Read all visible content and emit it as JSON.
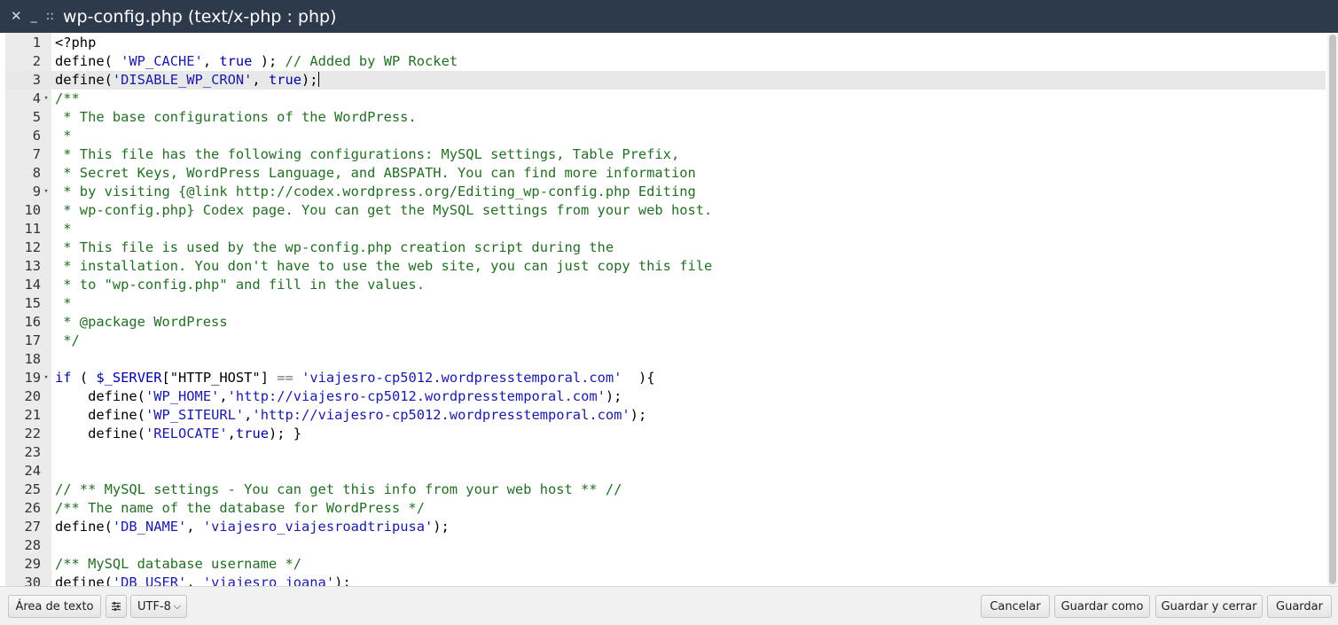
{
  "titlebar": {
    "close_glyph": "✕",
    "minimize_glyph": "_",
    "grip_glyph": "::",
    "title": "wp-config.php (text/x-php : php)"
  },
  "editor": {
    "lines": [
      {
        "n": "1",
        "fold": false,
        "active": false,
        "tokens": [
          [
            "plain",
            "<?php"
          ]
        ]
      },
      {
        "n": "2",
        "fold": false,
        "active": false,
        "tokens": [
          [
            "def",
            "define( "
          ],
          [
            "str",
            "'WP_CACHE'"
          ],
          [
            "plain",
            ", "
          ],
          [
            "kw",
            "true"
          ],
          [
            "plain",
            " ); "
          ],
          [
            "com",
            "// Added by WP Rocket"
          ]
        ]
      },
      {
        "n": "3",
        "fold": false,
        "active": true,
        "cursor": true,
        "tokens": [
          [
            "def",
            "define("
          ],
          [
            "str",
            "'DISABLE_WP_CRON'"
          ],
          [
            "plain",
            ", "
          ],
          [
            "kw",
            "true"
          ],
          [
            "plain",
            ");"
          ]
        ]
      },
      {
        "n": "4",
        "fold": true,
        "active": false,
        "tokens": [
          [
            "com",
            "/**"
          ]
        ]
      },
      {
        "n": "5",
        "fold": false,
        "active": false,
        "tokens": [
          [
            "com",
            " * The base configurations of the WordPress."
          ]
        ]
      },
      {
        "n": "6",
        "fold": false,
        "active": false,
        "tokens": [
          [
            "com",
            " *"
          ]
        ]
      },
      {
        "n": "7",
        "fold": false,
        "active": false,
        "tokens": [
          [
            "com",
            " * This file has the following configurations: MySQL settings, Table Prefix,"
          ]
        ]
      },
      {
        "n": "8",
        "fold": false,
        "active": false,
        "tokens": [
          [
            "com",
            " * Secret Keys, WordPress Language, and ABSPATH. You can find more information"
          ]
        ]
      },
      {
        "n": "9",
        "fold": true,
        "active": false,
        "tokens": [
          [
            "com",
            " * by visiting {@link http://codex.wordpress.org/Editing_wp-config.php Editing"
          ]
        ]
      },
      {
        "n": "10",
        "fold": false,
        "active": false,
        "tokens": [
          [
            "com",
            " * wp-config.php} Codex page. You can get the MySQL settings from your web host."
          ]
        ]
      },
      {
        "n": "11",
        "fold": false,
        "active": false,
        "tokens": [
          [
            "com",
            " *"
          ]
        ]
      },
      {
        "n": "12",
        "fold": false,
        "active": false,
        "tokens": [
          [
            "com",
            " * This file is used by the wp-config.php creation script during the"
          ]
        ]
      },
      {
        "n": "13",
        "fold": false,
        "active": false,
        "tokens": [
          [
            "com",
            " * installation. You don't have to use the web site, you can just copy this file"
          ]
        ]
      },
      {
        "n": "14",
        "fold": false,
        "active": false,
        "tokens": [
          [
            "com",
            " * to \"wp-config.php\" and fill in the values."
          ]
        ]
      },
      {
        "n": "15",
        "fold": false,
        "active": false,
        "tokens": [
          [
            "com",
            " *"
          ]
        ]
      },
      {
        "n": "16",
        "fold": false,
        "active": false,
        "tokens": [
          [
            "com",
            " * @package WordPress"
          ]
        ]
      },
      {
        "n": "17",
        "fold": false,
        "active": false,
        "tokens": [
          [
            "com",
            " */"
          ]
        ]
      },
      {
        "n": "18",
        "fold": false,
        "active": false,
        "tokens": []
      },
      {
        "n": "19",
        "fold": true,
        "active": false,
        "tokens": [
          [
            "kw",
            "if"
          ],
          [
            "plain",
            " ( "
          ],
          [
            "var",
            "$_SERVER"
          ],
          [
            "plain",
            "[\"HTTP_HOST\"] "
          ],
          [
            "op",
            "=="
          ],
          [
            "plain",
            " "
          ],
          [
            "str",
            "'viajesro-cp5012.wordpresstemporal.com'"
          ],
          [
            "plain",
            "  ){"
          ]
        ]
      },
      {
        "n": "20",
        "fold": false,
        "active": false,
        "tokens": [
          [
            "plain",
            "    "
          ],
          [
            "def",
            "define("
          ],
          [
            "str",
            "'WP_HOME'"
          ],
          [
            "plain",
            ","
          ],
          [
            "str",
            "'http://viajesro-cp5012.wordpresstemporal.com'"
          ],
          [
            "plain",
            ");"
          ]
        ]
      },
      {
        "n": "21",
        "fold": false,
        "active": false,
        "tokens": [
          [
            "plain",
            "    "
          ],
          [
            "def",
            "define("
          ],
          [
            "str",
            "'WP_SITEURL'"
          ],
          [
            "plain",
            ","
          ],
          [
            "str",
            "'http://viajesro-cp5012.wordpresstemporal.com'"
          ],
          [
            "plain",
            ");"
          ]
        ]
      },
      {
        "n": "22",
        "fold": false,
        "active": false,
        "tokens": [
          [
            "plain",
            "    "
          ],
          [
            "def",
            "define("
          ],
          [
            "str",
            "'RELOCATE'"
          ],
          [
            "plain",
            ","
          ],
          [
            "kw",
            "true"
          ],
          [
            "plain",
            "); }"
          ]
        ]
      },
      {
        "n": "23",
        "fold": false,
        "active": false,
        "tokens": []
      },
      {
        "n": "24",
        "fold": false,
        "active": false,
        "tokens": []
      },
      {
        "n": "25",
        "fold": false,
        "active": false,
        "tokens": [
          [
            "com",
            "// ** MySQL settings - You can get this info from your web host ** //"
          ]
        ]
      },
      {
        "n": "26",
        "fold": false,
        "active": false,
        "tokens": [
          [
            "com",
            "/** The name of the database for WordPress */"
          ]
        ]
      },
      {
        "n": "27",
        "fold": false,
        "active": false,
        "tokens": [
          [
            "def",
            "define("
          ],
          [
            "str",
            "'DB_NAME'"
          ],
          [
            "plain",
            ", "
          ],
          [
            "str",
            "'viajesro_viajesroadtripusa'"
          ],
          [
            "plain",
            ");"
          ]
        ]
      },
      {
        "n": "28",
        "fold": false,
        "active": false,
        "tokens": []
      },
      {
        "n": "29",
        "fold": false,
        "active": false,
        "tokens": [
          [
            "com",
            "/** MySQL database username */"
          ]
        ]
      },
      {
        "n": "30",
        "fold": false,
        "active": false,
        "tokens": [
          [
            "def",
            "define("
          ],
          [
            "str",
            "'DB_USER'"
          ],
          [
            "plain",
            ", "
          ],
          [
            "str",
            "'viajesro_joana'"
          ],
          [
            "plain",
            ");"
          ]
        ]
      }
    ]
  },
  "footer": {
    "textarea_label": "Área de texto",
    "settings_icon": "sliders-icon",
    "encoding": "UTF-8",
    "cancel_label": "Cancelar",
    "save_as_label": "Guardar como",
    "save_close_label": "Guardar y cerrar",
    "save_label": "Guardar"
  }
}
